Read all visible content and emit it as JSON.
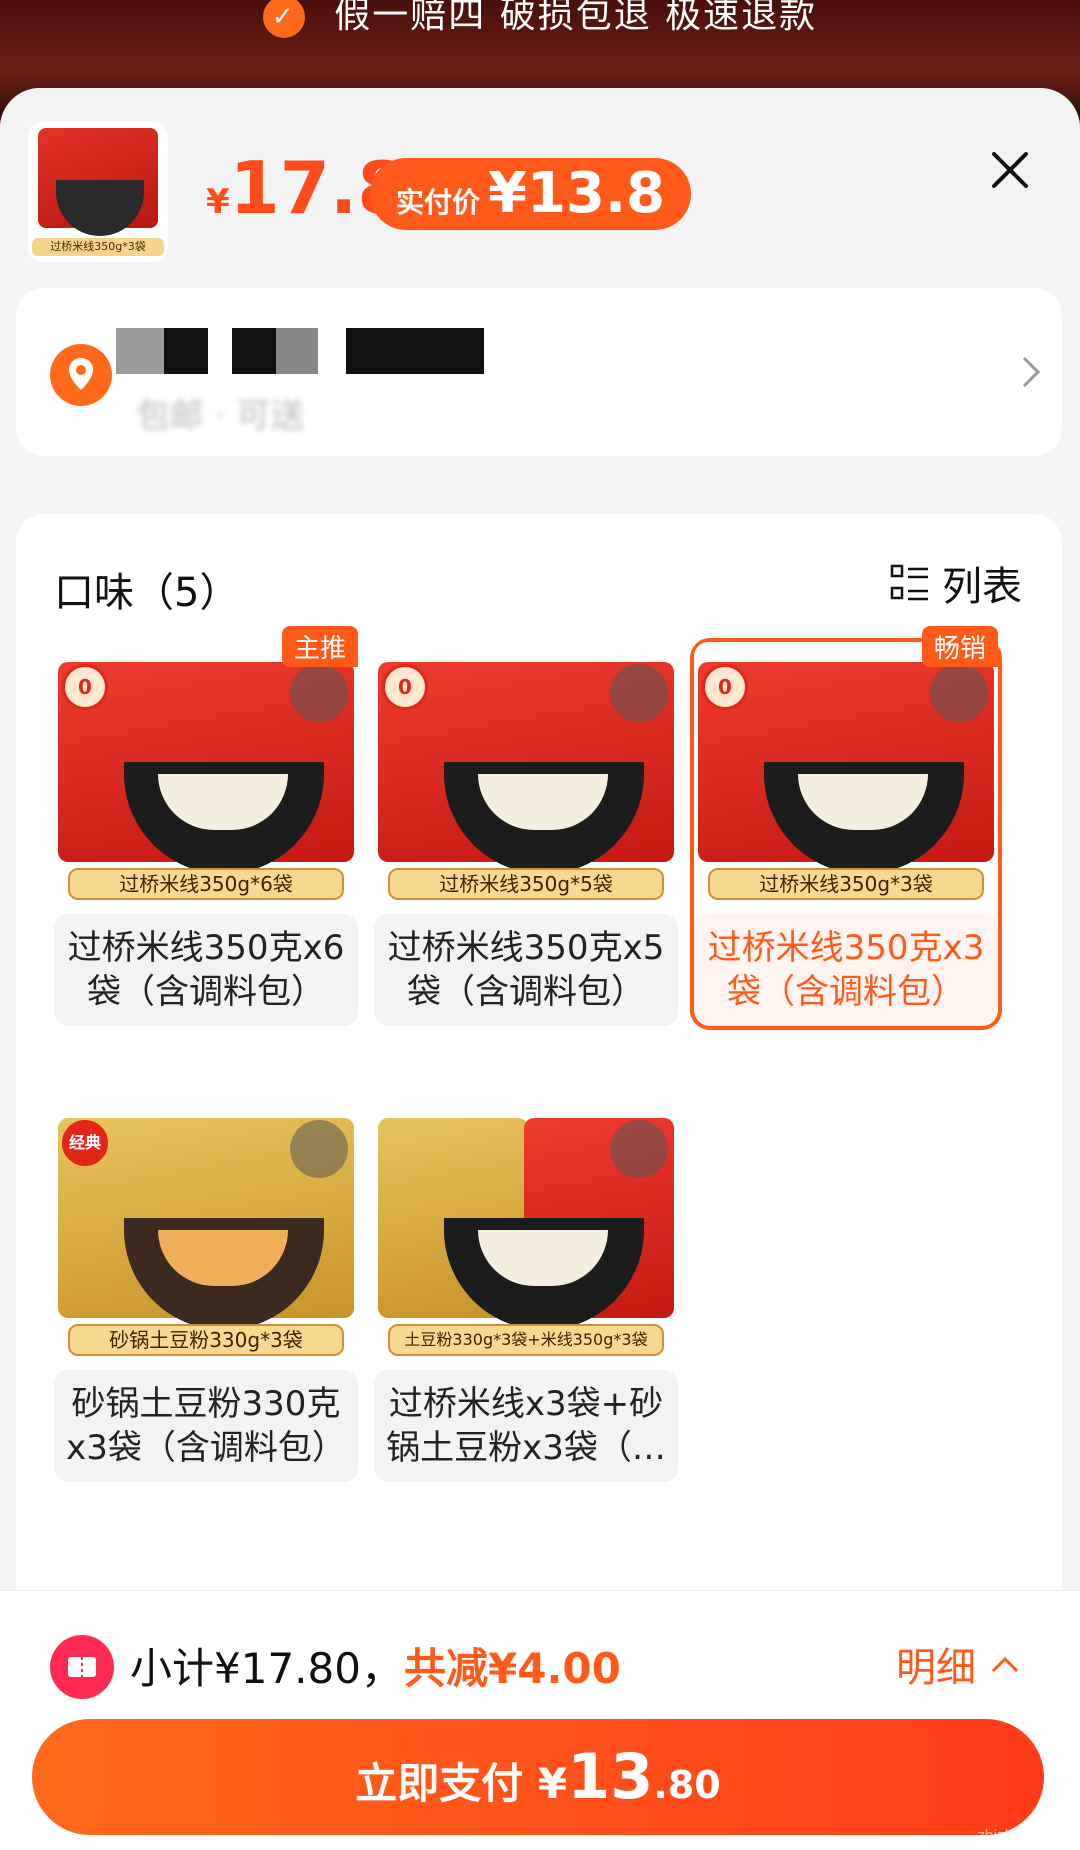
{
  "banner": {
    "text": "假一赔四  破损包退  极速退款"
  },
  "header": {
    "thumb_label": "过桥米线350g*3袋",
    "price_symbol": "¥",
    "price": "17.8",
    "paid_label": "实付价",
    "paid_amount": "¥13.8"
  },
  "address": {
    "shipping_text": "包邮 · 可送"
  },
  "options": {
    "title": "口味（5）",
    "view_toggle": "列表",
    "items": [
      {
        "tag": "主推",
        "caption": "过桥米线350g*6袋",
        "name": "过桥米线350克x6袋（含调料包）",
        "ribbon": "0",
        "kind": "noodle",
        "selected": false
      },
      {
        "tag": "",
        "caption": "过桥米线350g*5袋",
        "name": "过桥米线350克x5袋（含调料包）",
        "ribbon": "0",
        "kind": "noodle",
        "selected": false
      },
      {
        "tag": "畅销",
        "caption": "过桥米线350g*3袋",
        "name": "过桥米线350克x3袋（含调料包）",
        "ribbon": "0",
        "kind": "noodle",
        "selected": true
      },
      {
        "tag": "",
        "caption": "砂锅土豆粉330g*3袋",
        "name": "砂锅土豆粉330克x3袋（含调料包）",
        "ribbon": "经典",
        "kind": "potato",
        "selected": false
      },
      {
        "tag": "",
        "caption": "土豆粉330g*3袋+米线350g*3袋",
        "name": "过桥米线x3袋+砂锅土豆粉x3袋（…",
        "ribbon": "",
        "kind": "mixed",
        "selected": false
      }
    ]
  },
  "footer": {
    "subtotal": "小计¥17.80，",
    "discount": "共减¥4.00",
    "detail": "明细",
    "pay_label": "立即支付 ¥",
    "pay_int": "13",
    "pay_dec": ".80"
  },
  "watermark": "zhizhizhi.com",
  "colors": {
    "accent": "#ff5a1a",
    "price": "#ff4a1c",
    "coupon": "#ff2a52"
  }
}
